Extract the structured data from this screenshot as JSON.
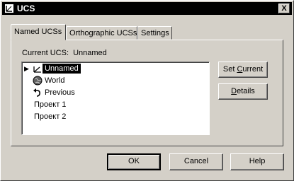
{
  "window": {
    "title": "UCS",
    "close_glyph": "X",
    "icon": "ucs-app-icon"
  },
  "tabs": [
    {
      "label": "Named UCSs",
      "active": true
    },
    {
      "label": "Orthographic UCSs",
      "active": false
    },
    {
      "label": "Settings",
      "active": false
    }
  ],
  "current_ucs": {
    "label": "Current UCS:",
    "value": "Unnamed"
  },
  "ucs_list": [
    {
      "label": "Unnamed",
      "icon": "ucs-axis-icon",
      "selected": true,
      "current_marker": "▶"
    },
    {
      "label": "World",
      "icon": "globe-icon",
      "selected": false
    },
    {
      "label": "Previous",
      "icon": "undo-arrow-icon",
      "selected": false
    },
    {
      "label": "Проект 1",
      "icon": null,
      "selected": false
    },
    {
      "label": "Проект 2",
      "icon": null,
      "selected": false
    }
  ],
  "side_buttons": {
    "set_current": {
      "pre": "Set ",
      "ul": "C",
      "post": "urrent"
    },
    "details": {
      "pre": "",
      "ul": "D",
      "post": "etails"
    }
  },
  "footer_buttons": {
    "ok": "OK",
    "cancel": "Cancel",
    "help": "Help"
  },
  "colors": {
    "face": "#d4d0c8",
    "titlebar": "#000000",
    "selection": "#000000"
  }
}
